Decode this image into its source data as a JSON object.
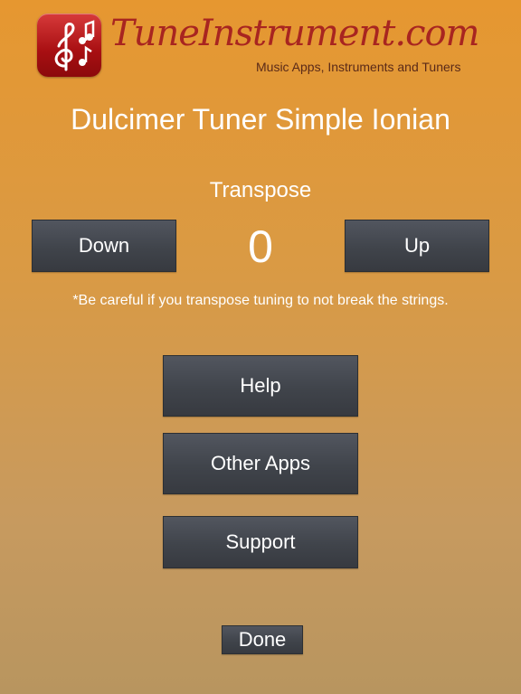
{
  "header": {
    "brand": "TuneInstrument.com",
    "tagline": "Music Apps, Instruments and Tuners",
    "logo_icon": "music-notes-icon"
  },
  "title": "Dulcimer Tuner Simple Ionian",
  "transpose": {
    "label": "Transpose",
    "value": "0",
    "down_label": "Down",
    "up_label": "Up",
    "warning": "*Be careful if you transpose tuning to not break the strings."
  },
  "menu": {
    "help_label": "Help",
    "other_apps_label": "Other Apps",
    "support_label": "Support"
  },
  "done_label": "Done",
  "colors": {
    "background_top": "#e69730",
    "background_bottom": "#b8955f",
    "button": "#40444b",
    "brand": "#a82520"
  }
}
